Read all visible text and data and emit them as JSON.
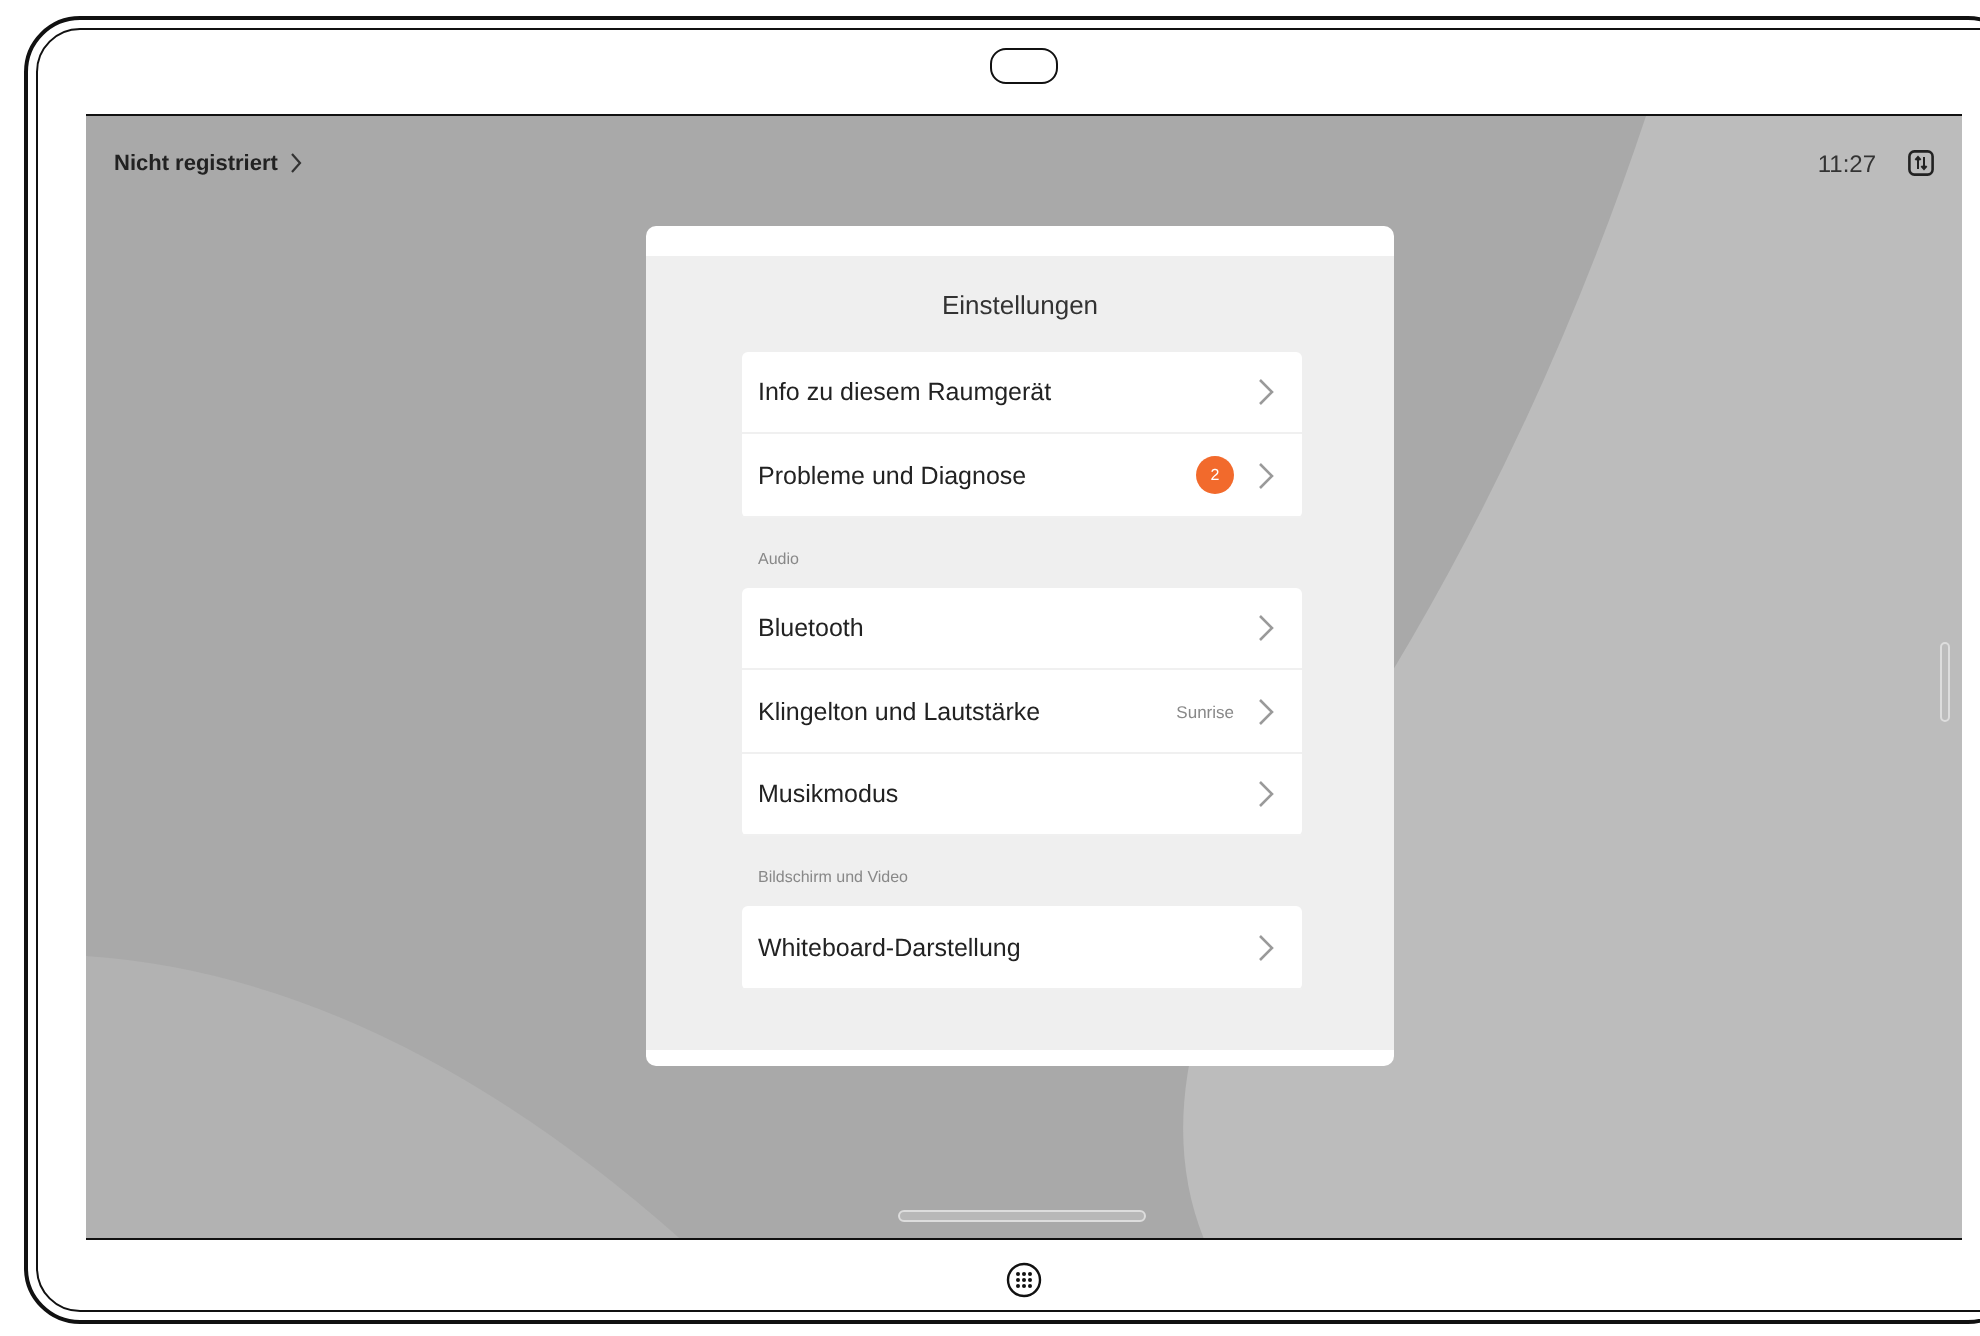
{
  "status_bar": {
    "registration": "Nicht registriert",
    "time": "11:27"
  },
  "settings": {
    "title": "Einstellungen",
    "groups": [
      {
        "items": [
          {
            "label": "Info zu diesem Raumgerät"
          },
          {
            "label": "Probleme und Diagnose",
            "badge": "2"
          }
        ]
      },
      {
        "header": "Audio",
        "items": [
          {
            "label": "Bluetooth"
          },
          {
            "label": "Klingelton und Lautstärke",
            "value": "Sunrise"
          },
          {
            "label": "Musikmodus"
          }
        ]
      },
      {
        "header": "Bildschirm und Video",
        "items": [
          {
            "label": "Whiteboard-Darstellung"
          }
        ]
      }
    ]
  }
}
